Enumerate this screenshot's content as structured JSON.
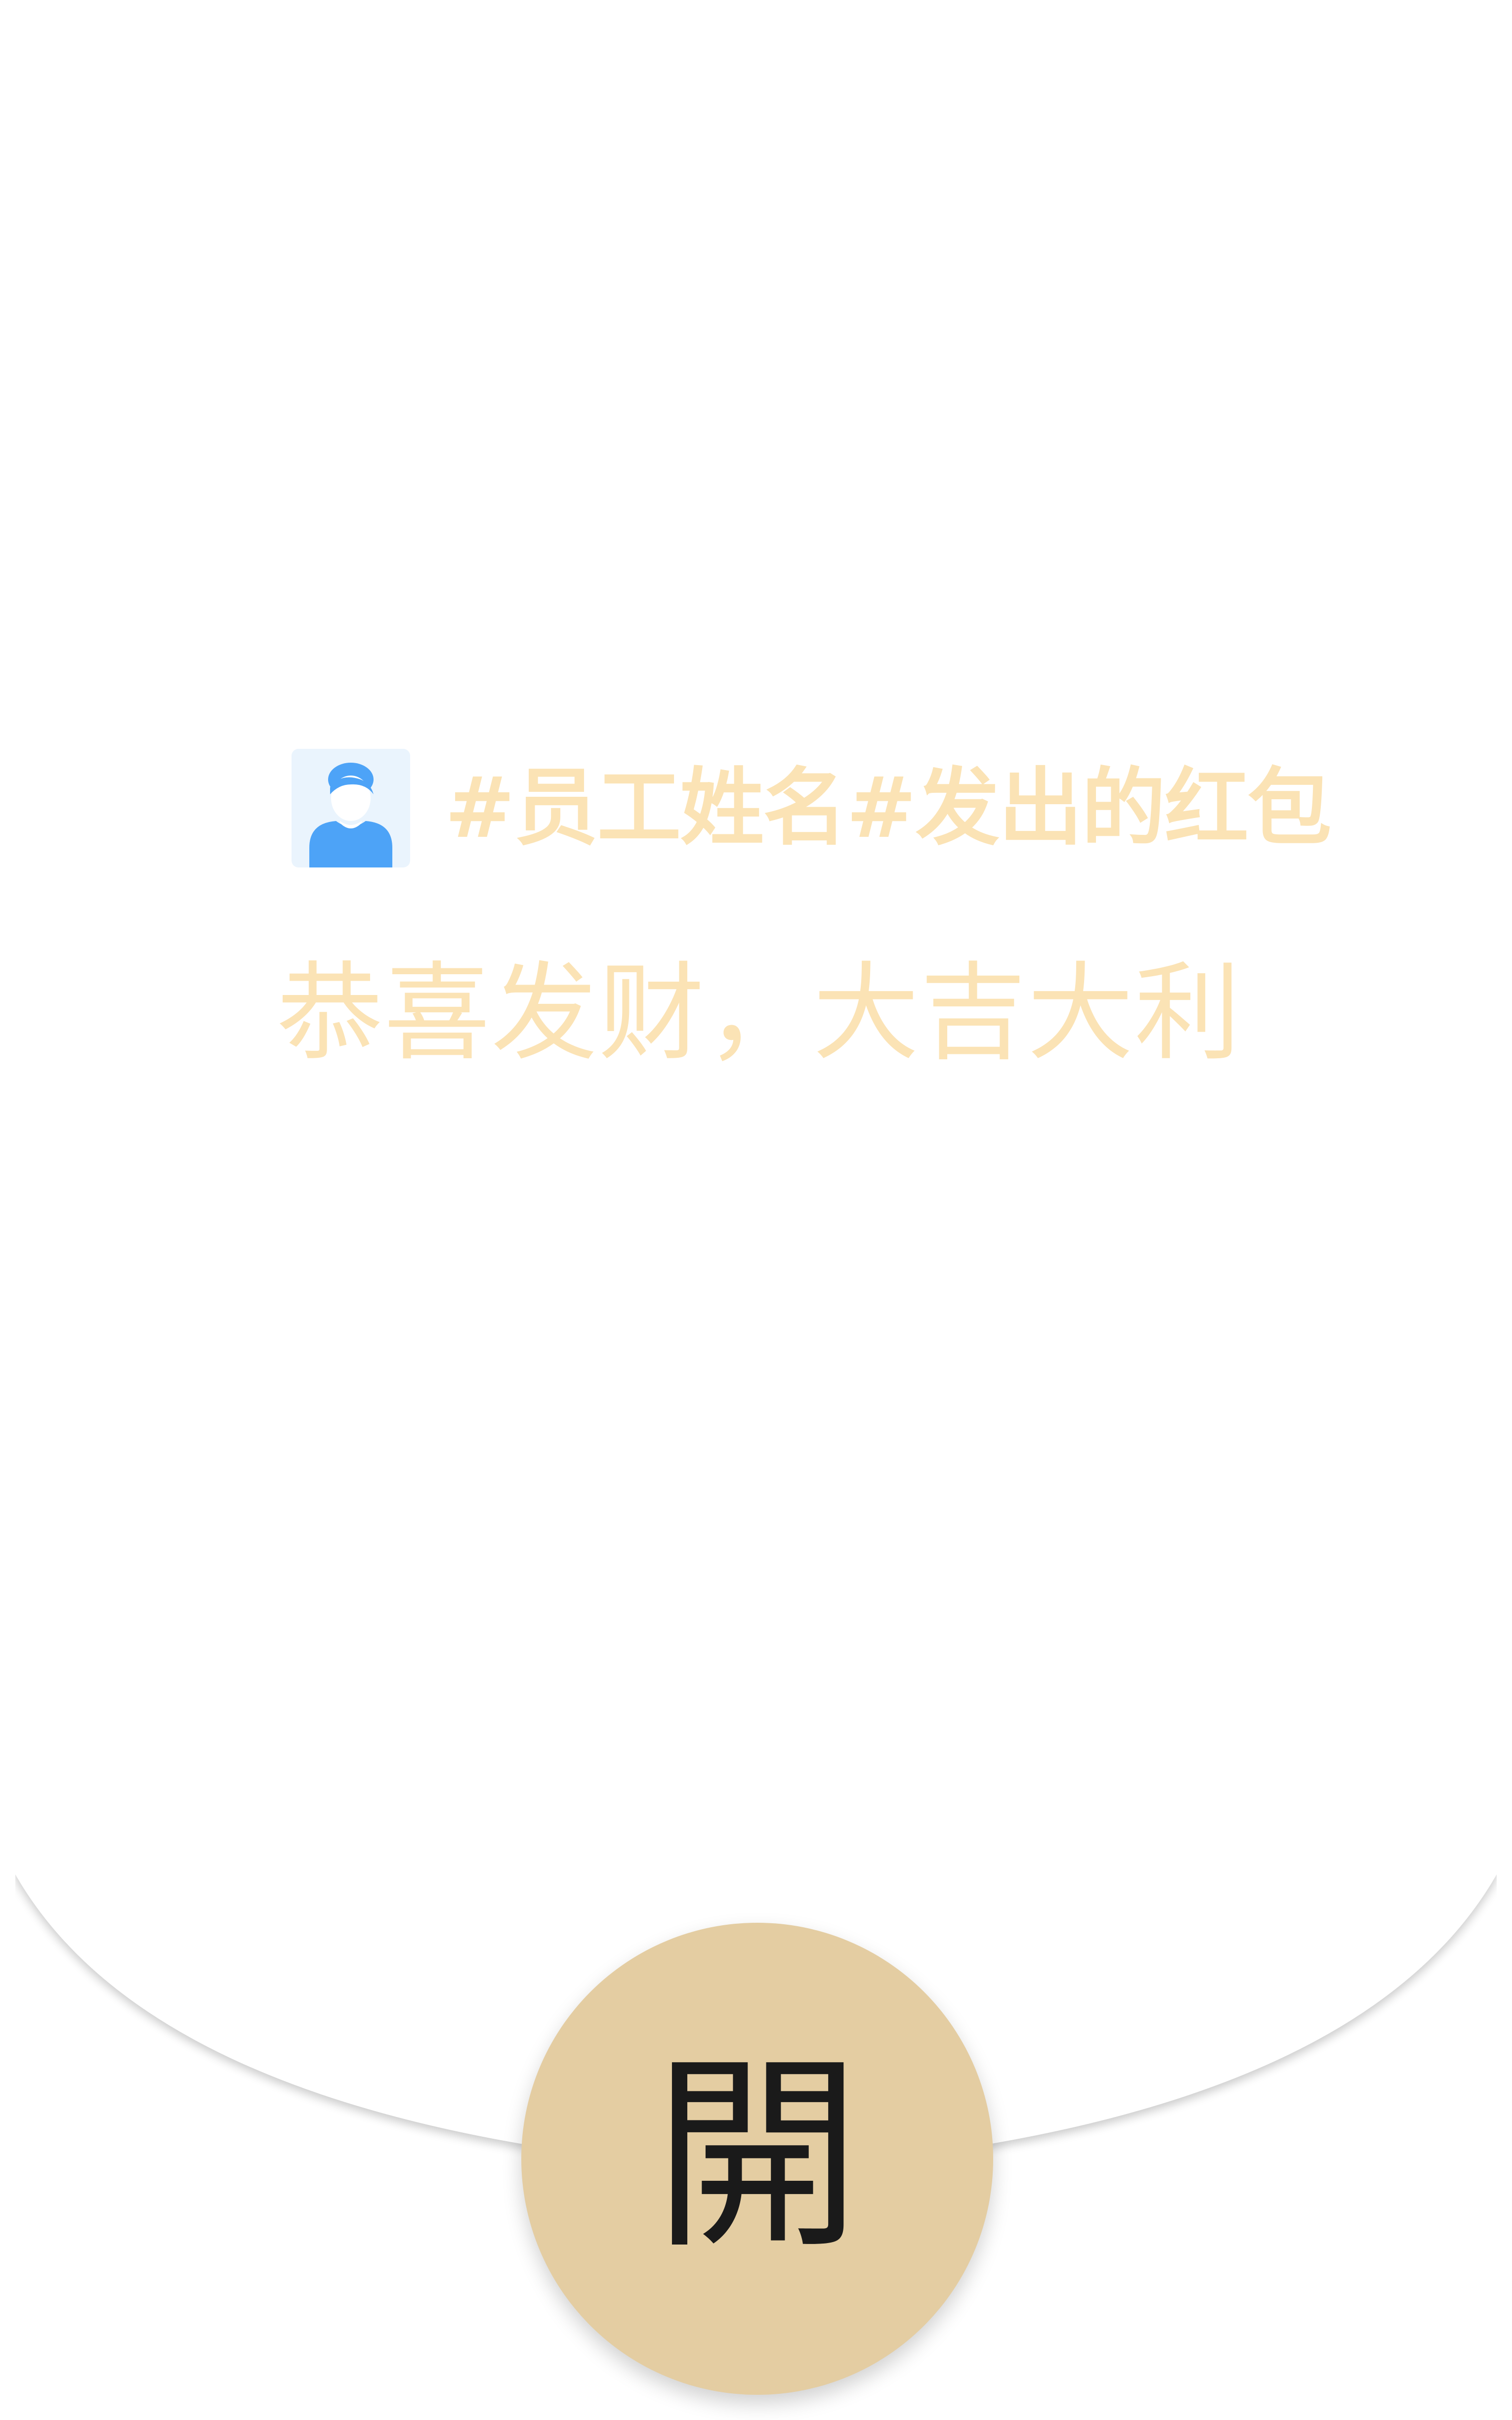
{
  "packet": {
    "sender_line": "#员工姓名#发出的红包",
    "greeting": "恭喜发财，大吉大利",
    "open_label": "開"
  },
  "icons": {
    "avatar": "user-avatar-icon"
  },
  "colors": {
    "text_gold": "#fbe3b5",
    "button_gold": "#e4cda2",
    "avatar_blue": "#4da3f7",
    "avatar_bg": "#eaf4fd"
  }
}
